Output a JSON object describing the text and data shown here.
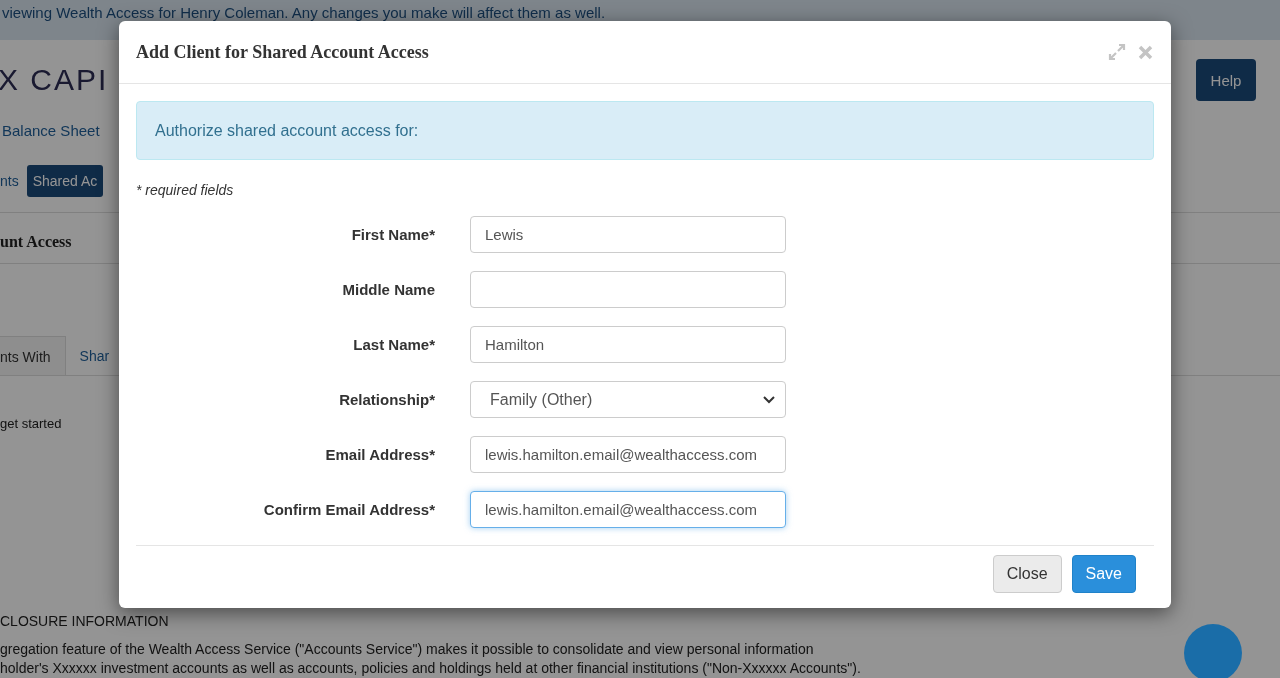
{
  "background": {
    "banner": "viewing Wealth Access for Henry Coleman. Any changes you make will affect them as well.",
    "logo": "X CAPI",
    "help_button": "Help",
    "nav_link": "Balance Sheet",
    "tabs": [
      {
        "label": "nts",
        "selected": false
      },
      {
        "label": "Shared Ac",
        "selected": true
      }
    ],
    "section_title": "unt Access",
    "subtabs": [
      {
        "label": "nts With",
        "selected": true
      },
      {
        "label": "Shar",
        "selected": false
      }
    ],
    "hint": "get started",
    "disclosure_title": "CLOSURE INFORMATION",
    "disclosure_lines": [
      "gregation feature of the Wealth Access Service (\"Accounts Service\") makes it possible to consolidate and view personal information",
      "holder's Xxxxxx investment accounts as well as accounts, policies and holdings held at other financial institutions (\"Non-Xxxxxx Accounts\")."
    ]
  },
  "dialog": {
    "title": "Add Client for Shared Account Access",
    "alert": "Authorize shared account access for:",
    "required_note": "* required fields",
    "fields": [
      {
        "kind": "text",
        "label": "First Name*",
        "value": "Lewis",
        "focused": false
      },
      {
        "kind": "text",
        "label": "Middle Name",
        "focused": false
      },
      {
        "kind": "text",
        "label": "Last Name*",
        "value": "Hamilton",
        "focused": false
      },
      {
        "kind": "select",
        "label": "Relationship*",
        "value": "Family (Other)",
        "focused": false
      },
      {
        "kind": "text",
        "label": "Email Address*",
        "value": "lewis.hamilton.email@wealthaccess.com",
        "focused": false
      },
      {
        "kind": "text",
        "label": "Confirm Email Address*",
        "value": "lewis.hamilton.email@wealthaccess.com",
        "focused": true
      }
    ],
    "buttons": [
      {
        "kind": "secondary",
        "label": "Close"
      },
      {
        "kind": "primary",
        "label": "Save"
      }
    ]
  }
}
